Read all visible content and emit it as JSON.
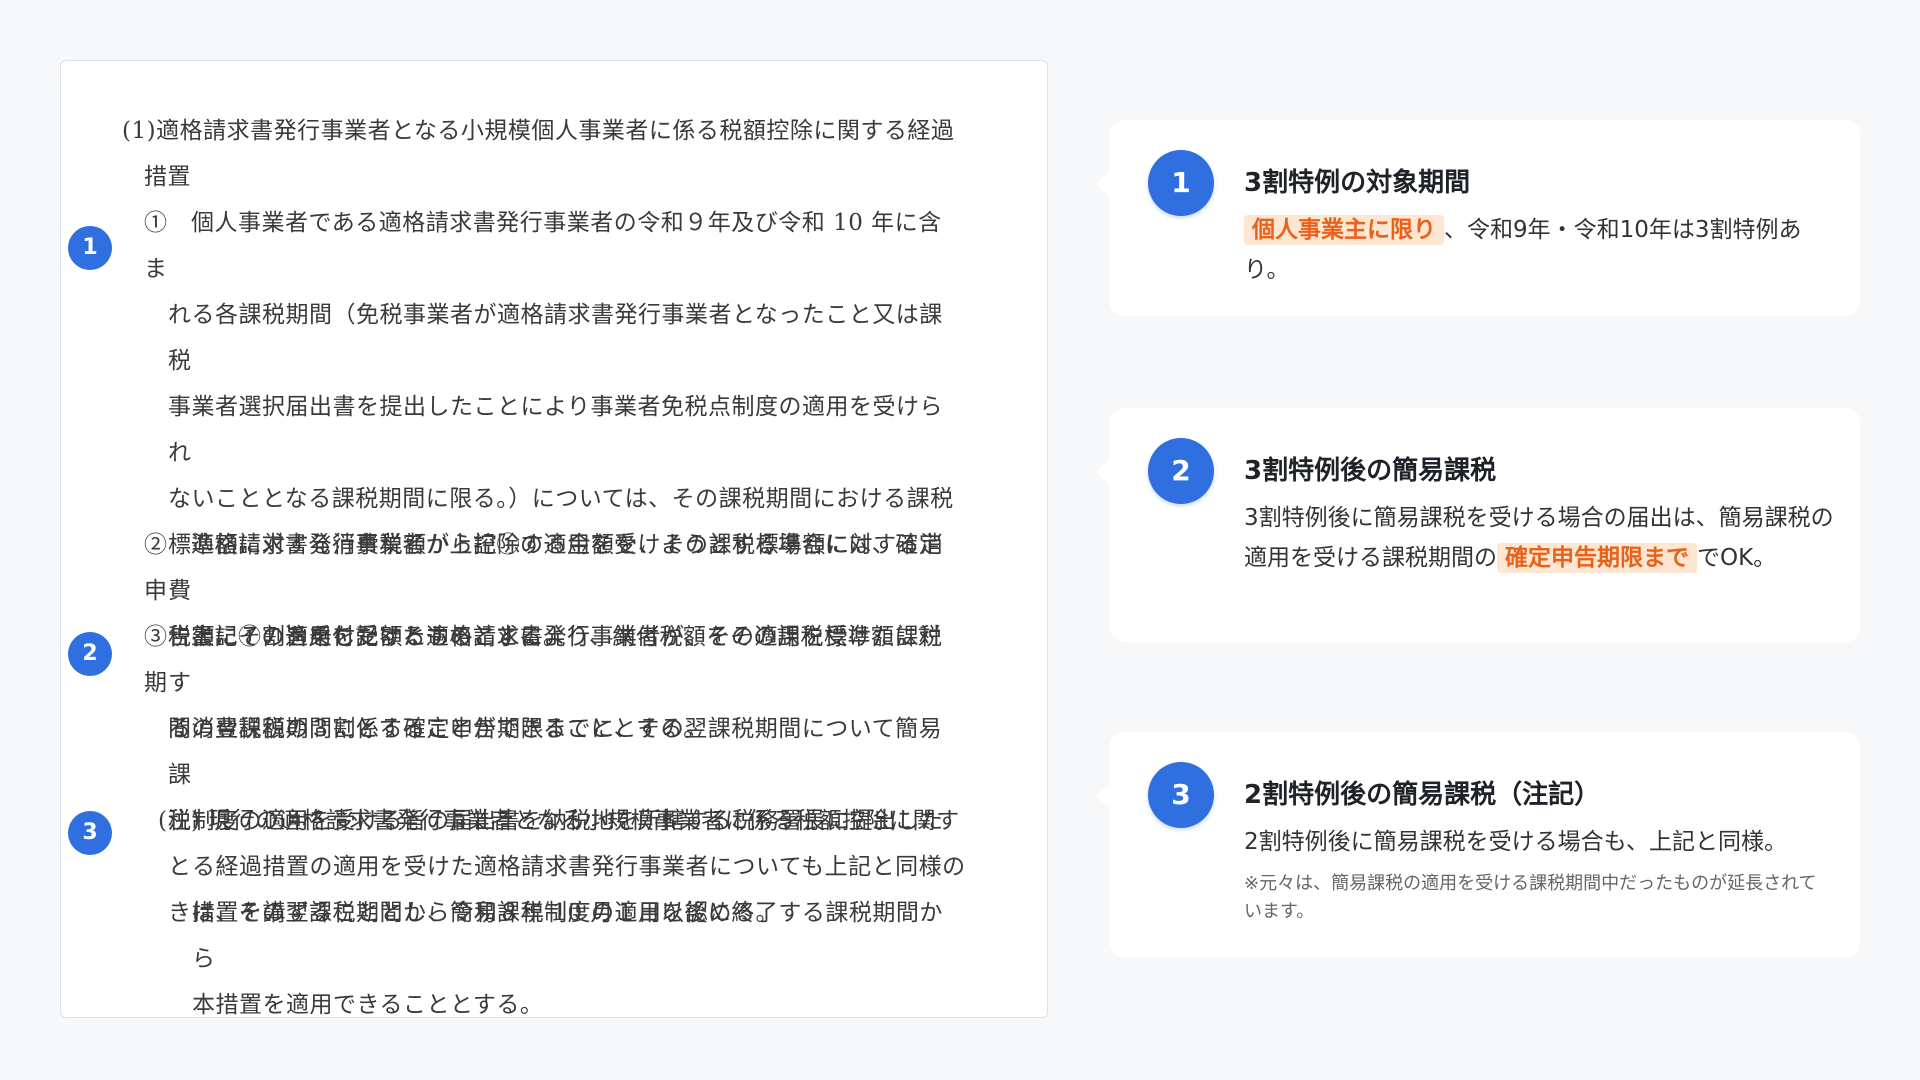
{
  "document": {
    "heading": [
      "(1)適格請求書発行事業者となる小規模個人事業者に係る税額控除に関する経過",
      "措置"
    ],
    "item1": {
      "lead": "①　個人事業者である適格請求書発行事業者の令和９年及び令和 10 年に含ま",
      "rest": [
        "れる各課税期間（免税事業者が適格請求書発行事業者となったこと又は課税",
        "事業者選択届出書を提出したことにより事業者免税点制度の適用を受けられ",
        "ないこととなる課税期間に限る。）については、その課税期間における課税",
        "標準額に対する消費税額から控除する金額を、その課税標準額に対する消費",
        "税額に７割を乗じた額とすることにより、納付税額をその課税標準額に対す",
        "る消費税額の３割とすることができることとする。"
      ]
    },
    "item2": {
      "lead": "②　適格請求書発行事業者が上記①の適用を受けようとする場合には、確定申",
      "rest": [
        "告書にその旨を付記するものとする。"
      ]
    },
    "item3": {
      "lead": "③　上記①の適用を受けた適格請求書発行事業者が、その適用を受けた課税期",
      "rest": [
        "間の翌課税期間に係る確定申告期限までに、その翌課税期間について簡易課",
        "税制度の適用を受ける旨の届出書を納税地を所轄する税務署長に提出したと",
        "きは、その翌課税期間から簡易課税制度の適用を認める。"
      ]
    },
    "note": {
      "lead": "(注) 現行の適格請求書発行事業者となる小規模事業者に係る税額控除に関す",
      "rest": [
        "る経過措置の適用を受けた適格請求書発行事業者についても上記と同様の",
        "措置を講ずることとし、令和８年 10 月１日以後に終了する課税期間から",
        "本措置を適用できることとする。"
      ]
    },
    "badges": [
      "1",
      "2",
      "3"
    ]
  },
  "cards": [
    {
      "number": "1",
      "title": "3割特例の対象期間",
      "highlight": "個人事業主に限り",
      "after": "、令和9年・令和10年は3割特例あり。"
    },
    {
      "number": "2",
      "title": "3割特例後の簡易課税",
      "before": "3割特例後に簡易課税を受ける場合の届出は、簡易課税の適用を受ける課税期間の",
      "highlight": "確定申告期限まで",
      "after": "でOK。"
    },
    {
      "number": "3",
      "title": "2割特例後の簡易課税（注記）",
      "body": "2割特例後に簡易課税を受ける場合も、上記と同様。",
      "note": "※元々は、簡易課税の適用を受ける課税期間中だったものが延長されています。"
    }
  ],
  "colors": {
    "accent": "#2f6fe0",
    "highlight_text": "#e8621c",
    "highlight_bg": "#fde7d3"
  }
}
